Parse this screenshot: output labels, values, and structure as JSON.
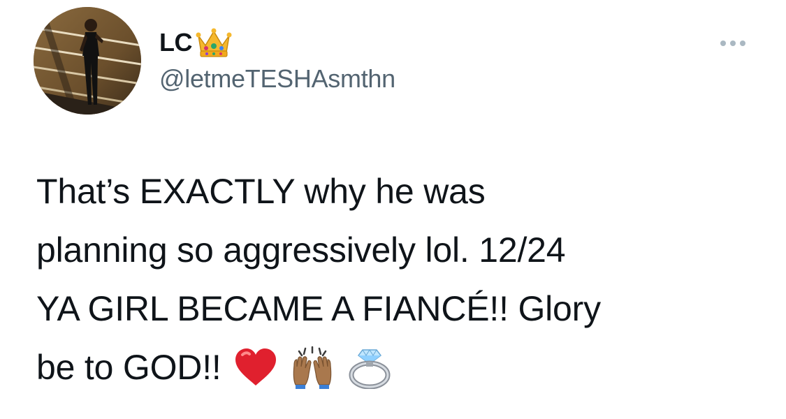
{
  "user": {
    "display_name": "LC",
    "handle": "@letmeTESHAsmthn",
    "name_emoji": "crown-icon"
  },
  "tweet": {
    "lines": [
      "That’s EXACTLY why he was",
      "planning so aggressively lol. 12/24",
      "YA GIRL BECAME A FIANCÉ!! Glory",
      "be to GOD!!"
    ],
    "trailing_emojis": [
      "red-heart-icon",
      "raising-hands-icon",
      "ring-icon"
    ]
  },
  "colors": {
    "text": "#0f1419",
    "secondary_text": "#536471",
    "menu_dots": "#aab8c2"
  }
}
